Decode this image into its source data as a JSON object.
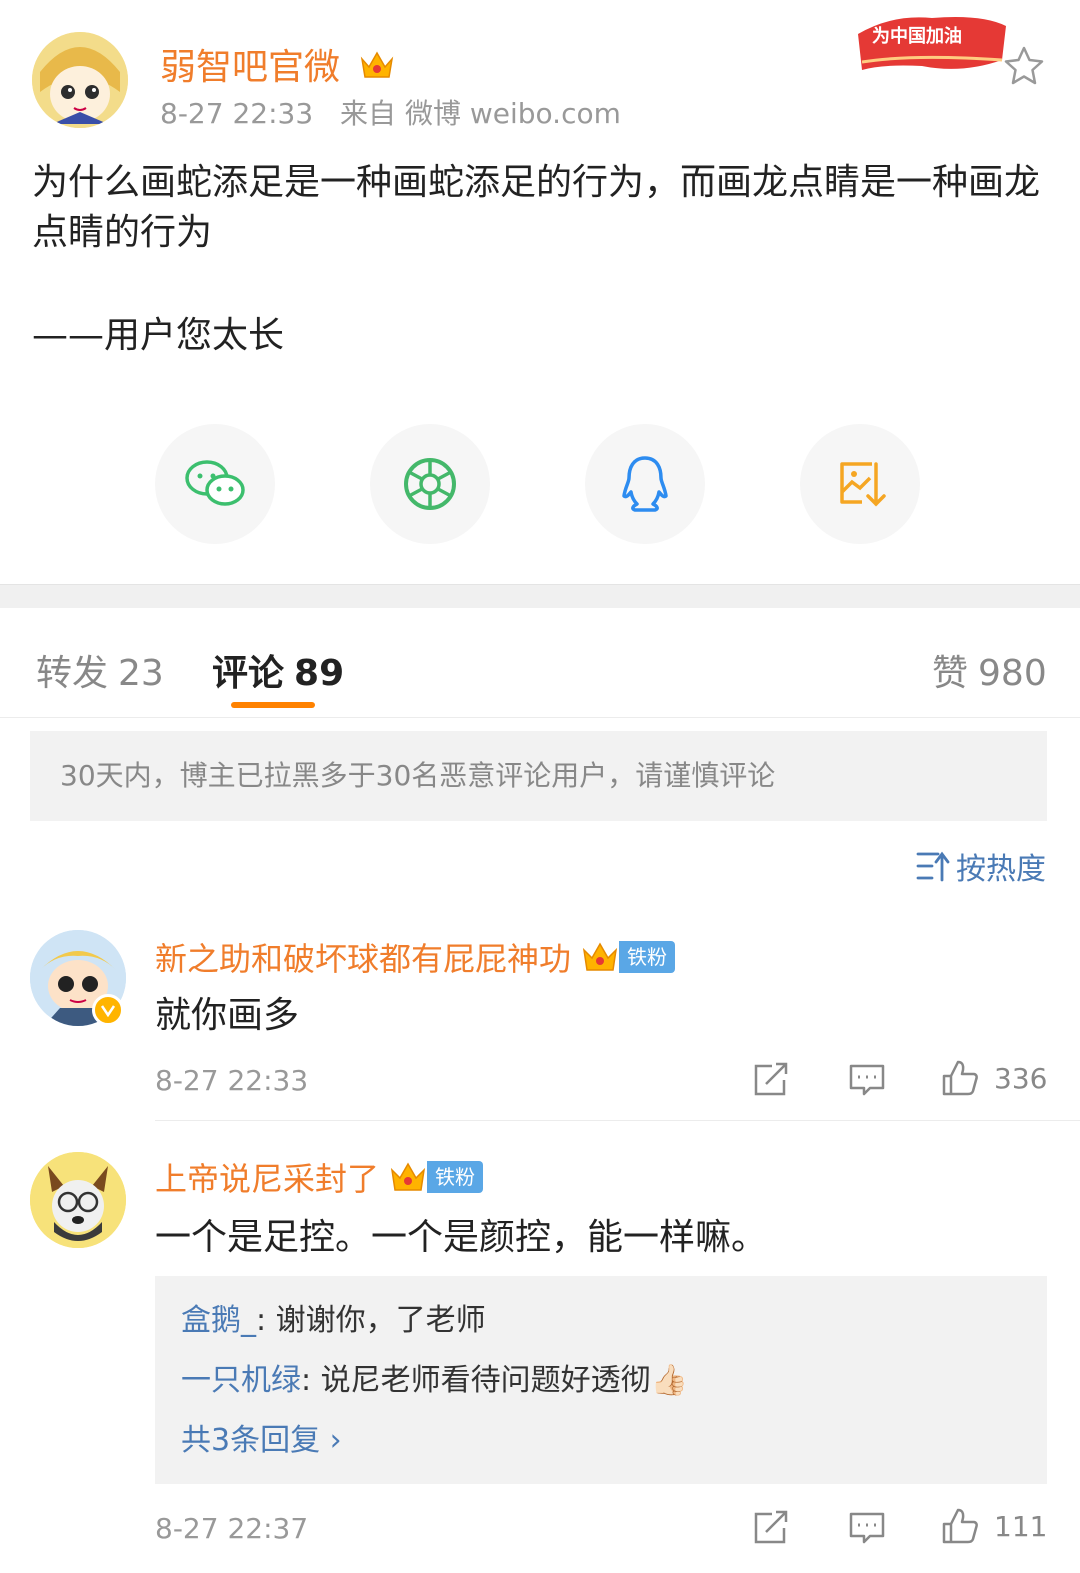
{
  "post": {
    "author": "弱智吧官微",
    "time": "8-27 22:33",
    "source": "来自 微博 weibo.com",
    "badge_text": "为中国加油",
    "body": "为什么画蛇添足是一种画蛇添足的行为，而画龙点睛是一种画龙点睛的行为",
    "signature": "——用户您太长"
  },
  "share": [
    {
      "name": "wechat-icon",
      "color": "#3cbf6e"
    },
    {
      "name": "moments-icon",
      "color": "#44b86a"
    },
    {
      "name": "qq-icon",
      "color": "#2d8cf0"
    },
    {
      "name": "save-image-icon",
      "color": "#f5a623"
    }
  ],
  "tabs": {
    "repost_label": "转发",
    "repost_count": "23",
    "comment_label": "评论",
    "comment_count": "89",
    "like_label": "赞",
    "like_count": "980"
  },
  "notice": "30天内，博主已拉黑多于30名恶意评论用户，请谨慎评论",
  "sort_label": "按热度",
  "comments": [
    {
      "author": "新之助和破坏球都有屁屁神功",
      "fan_badge": "铁粉",
      "text": "就你画多",
      "time": "8-27 22:33",
      "likes": "336"
    },
    {
      "author": "上帝说尼采封了",
      "fan_badge": "铁粉",
      "text": "一个是足控。一个是颜控，能一样嘛。",
      "time": "8-27 22:37",
      "likes": "111",
      "replies": [
        {
          "name": "盒鹅_",
          "text": ": 谢谢你，了老师"
        },
        {
          "name": "一只机绿",
          "text": ": 说尼老师看待问题好透彻👍🏻"
        }
      ],
      "more_replies": "共3条回复 ›"
    }
  ],
  "colors": {
    "accent_orange": "#ff8200",
    "username_orange": "#f07d2b",
    "link_blue": "#4a7ab5"
  }
}
